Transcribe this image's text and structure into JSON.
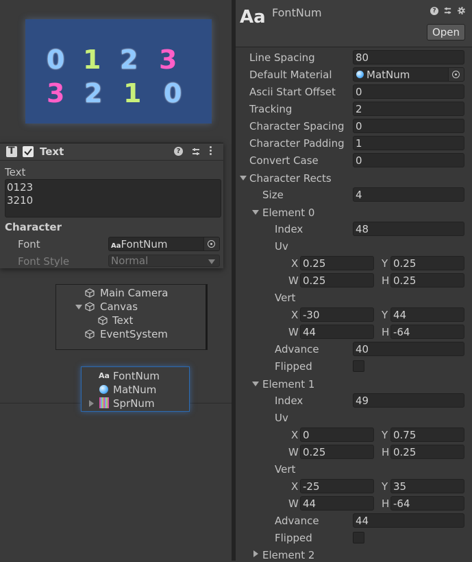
{
  "preview": {
    "row1": [
      "0",
      "1",
      "2",
      "3"
    ],
    "row2": [
      "3",
      "2",
      "1",
      "0"
    ]
  },
  "text_component": {
    "title": "Text",
    "text_label": "Text",
    "text_value_line1": "0123",
    "text_value_line2": "3210",
    "character_header": "Character",
    "font_label": "Font",
    "font_value": "FontNum",
    "font_style_label": "Font Style",
    "font_style_value": "Normal"
  },
  "hierarchy": {
    "items": [
      {
        "label": "Main Camera"
      },
      {
        "label": "Canvas"
      },
      {
        "label": "Text"
      },
      {
        "label": "EventSystem"
      }
    ]
  },
  "project": {
    "items": [
      {
        "label": "FontNum",
        "icon": "font-asset-icon"
      },
      {
        "label": "MatNum",
        "icon": "material-icon"
      },
      {
        "label": "SprNum",
        "icon": "sprite-icon"
      }
    ]
  },
  "inspector": {
    "icon_text": "Aa",
    "asset_name": "FontNum",
    "open_label": "Open",
    "line_spacing_label": "Line Spacing",
    "line_spacing": "80",
    "default_material_label": "Default Material",
    "default_material": "MatNum",
    "ascii_start_offset_label": "Ascii Start Offset",
    "ascii_start_offset": "0",
    "tracking_label": "Tracking",
    "tracking": "2",
    "character_spacing_label": "Character Spacing",
    "character_spacing": "0",
    "character_padding_label": "Character Padding",
    "character_padding": "1",
    "convert_case_label": "Convert Case",
    "convert_case": "0",
    "character_rects_label": "Character Rects",
    "size_label": "Size",
    "size": "4",
    "index_label": "Index",
    "uv_label": "Uv",
    "vert_label": "Vert",
    "advance_label": "Advance",
    "flipped_label": "Flipped",
    "x_label": "X",
    "y_label": "Y",
    "w_label": "W",
    "h_label": "H",
    "elements": [
      {
        "label": "Element 0",
        "index": "48",
        "uv_x": "0.25",
        "uv_y": "0.25",
        "uv_w": "0.25",
        "uv_h": "0.25",
        "vert_x": "-30",
        "vert_y": "44",
        "vert_w": "44",
        "vert_h": "-64",
        "advance": "40"
      },
      {
        "label": "Element 1",
        "index": "49",
        "uv_x": "0",
        "uv_y": "0.75",
        "uv_w": "0.25",
        "uv_h": "0.25",
        "vert_x": "-25",
        "vert_y": "35",
        "vert_w": "44",
        "vert_h": "-64",
        "advance": "44"
      },
      {
        "label": "Element 2"
      }
    ]
  }
}
